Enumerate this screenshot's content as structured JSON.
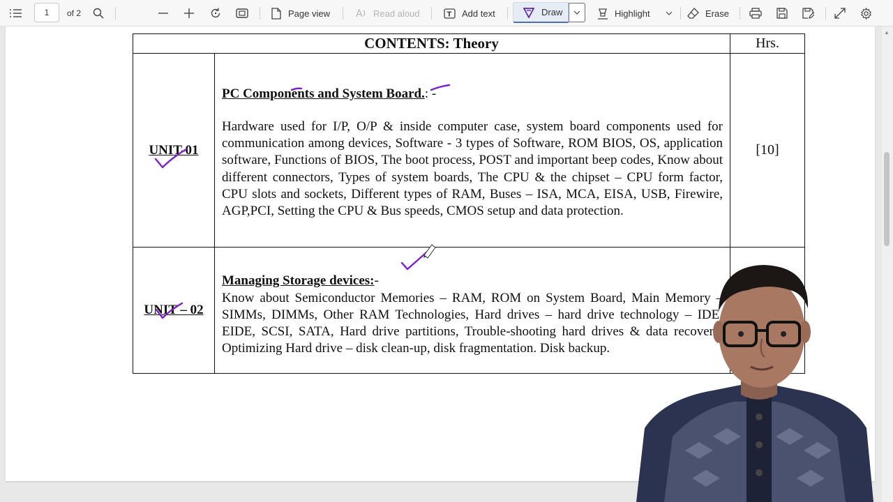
{
  "toolbar": {
    "page_number": "1",
    "page_total": "of 2",
    "page_view_label": "Page view",
    "read_aloud_label": "Read aloud",
    "add_text_label": "Add text",
    "draw_label": "Draw",
    "highlight_label": "Highlight",
    "erase_label": "Erase",
    "accent_color": "#4a6fb5",
    "pen_color": "#7b1fd0"
  },
  "document": {
    "header_title": "CONTENTS: Theory",
    "header_hrs": "Hrs.",
    "units": [
      {
        "label": "UNIT-01",
        "heading": "PC Components and System Board.",
        "heading_suffix": ": -",
        "body": "Hardware used for I/P, O/P & inside computer case, system board components used for communication among devices, Software - 3 types of Software, ROM BIOS, OS, application software, Functions of BIOS, The boot process, POST and important beep codes, Know about different connectors, Types of system boards, The CPU & the chipset – CPU form factor, CPU slots and sockets, Different types of RAM, Buses – ISA, MCA, EISA, USB, Firewire, AGP,PCI, Setting the CPU & Bus speeds, CMOS setup and data protection.",
        "hours": "[10]"
      },
      {
        "label": "UNIT – 02",
        "heading": "Managing Storage devices:",
        "heading_suffix": "-",
        "body": "Know about Semiconductor Memories – RAM, ROM on System Board, Main Memory – SIMMs, DIMMs, Other RAM Technologies, Hard drives – hard drive technology – IDE, EIDE, SCSI, SATA, Hard drive partitions, Trouble-shooting hard drives & data recovery, Optimizing Hard drive – disk clean-up, disk fragmentation. Disk backup.",
        "hours": ""
      }
    ]
  }
}
